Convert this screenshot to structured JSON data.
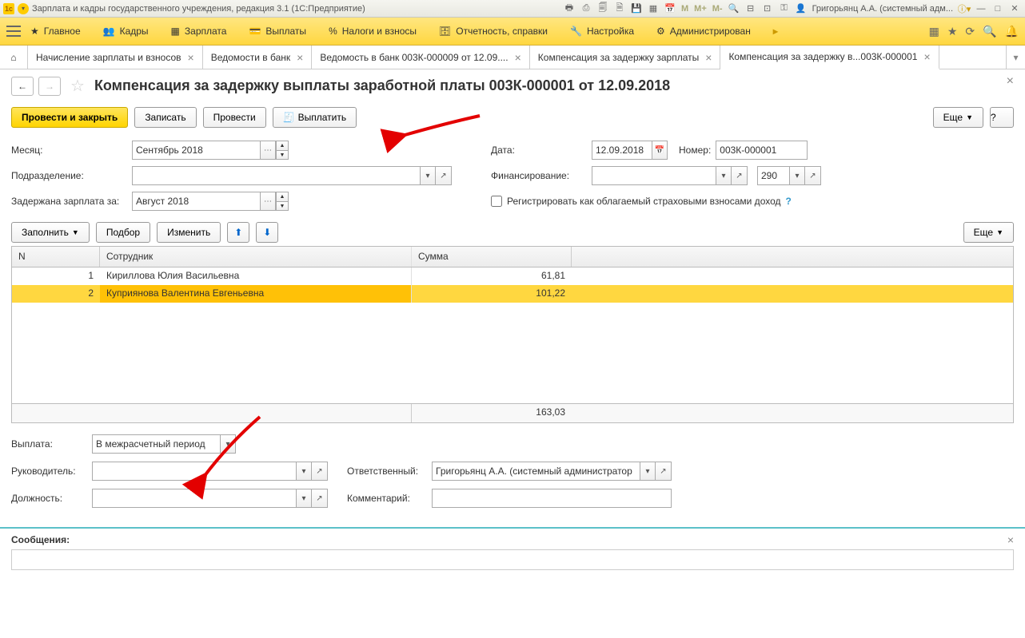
{
  "titlebar": {
    "app_title": "Зарплата и кадры государственного учреждения, редакция 3.1  (1С:Предприятие)",
    "user": "Григорьянц А.А. (системный адм...",
    "m": "M",
    "mplus": "M+",
    "mminus": "M-"
  },
  "maintb": {
    "items": [
      "Главное",
      "Кадры",
      "Зарплата",
      "Выплаты",
      "Налоги и взносы",
      "Отчетность, справки",
      "Настройка",
      "Администрирован"
    ]
  },
  "tabs": [
    "Начисление зарплаты и взносов",
    "Ведомости в банк",
    "Ведомость в банк 003К-000009 от 12.09....",
    "Компенсация за задержку зарплаты",
    "Компенсация за задержку в...003К-000001"
  ],
  "page": {
    "title": "Компенсация за задержку выплаты заработной платы 003К-000001 от 12.09.2018",
    "btn_primary": "Провести и закрыть",
    "btn_write": "Записать",
    "btn_post": "Провести",
    "btn_pay": "Выплатить",
    "btn_more": "Еще",
    "btn_help": "?"
  },
  "fields": {
    "month_label": "Месяц:",
    "month_value": "Сентябрь 2018",
    "dept_label": "Подразделение:",
    "dept_value": "",
    "delayed_label": "Задержана зарплата за:",
    "delayed_value": "Август 2018",
    "date_label": "Дата:",
    "date_value": "12.09.2018",
    "num_label": "Номер:",
    "num_value": "003К-000001",
    "fin_label": "Финансирование:",
    "fin_value": "",
    "fin_code": "290",
    "reg_label": "Регистрировать как облагаемый страховыми взносами доход"
  },
  "tbl": {
    "btn_fill": "Заполнить",
    "btn_pick": "Подбор",
    "btn_edit": "Изменить",
    "btn_more": "Еще",
    "cols": {
      "n": "N",
      "emp": "Сотрудник",
      "sum": "Сумма"
    },
    "rows": [
      {
        "n": "1",
        "emp": "Кириллова Юлия Васильевна",
        "sum": "61,81"
      },
      {
        "n": "2",
        "emp": "Куприянова Валентина Евгеньевна",
        "sum": "101,22"
      }
    ],
    "total": "163,03"
  },
  "bottom": {
    "pay_label": "Выплата:",
    "pay_value": "В межрасчетный период",
    "head_label": "Руководитель:",
    "head_value": "",
    "resp_label": "Ответственный:",
    "resp_value": "Григорьянц А.А. (системный администратор",
    "pos_label": "Должность:",
    "pos_value": "",
    "comment_label": "Комментарий:",
    "comment_value": ""
  },
  "msgs": {
    "label": "Сообщения:"
  }
}
